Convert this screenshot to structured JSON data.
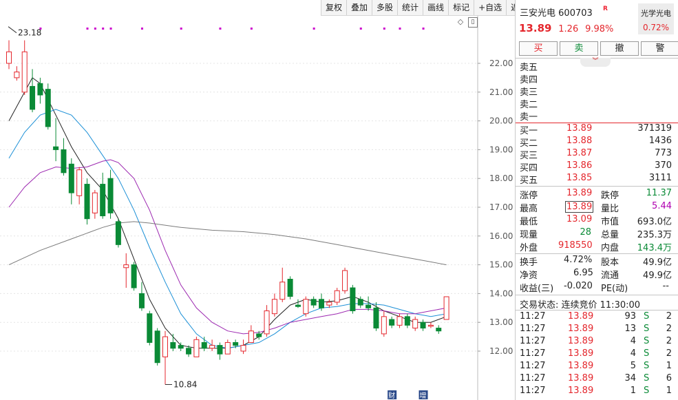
{
  "toolbar": {
    "items": [
      "复权",
      "叠加",
      "多股",
      "统计",
      "画线",
      "标记",
      "+自选",
      "返回"
    ]
  },
  "chart_data": {
    "type": "candlestick",
    "y_ticks": [
      "22.00",
      "21.00",
      "20.00",
      "19.00",
      "18.00",
      "17.00",
      "16.00",
      "15.00",
      "14.00",
      "13.00",
      "12.00"
    ],
    "ylim": [
      11.0,
      23.8
    ],
    "high_label": "23.18",
    "low_label": "10.84",
    "candles": [
      {
        "o": 22.0,
        "c": 22.4,
        "h": 22.8,
        "l": 21.8
      },
      {
        "o": 21.5,
        "c": 21.7,
        "h": 21.9,
        "l": 21.4
      },
      {
        "o": 21.0,
        "c": 22.4,
        "h": 22.8,
        "l": 20.9
      },
      {
        "o": 21.2,
        "c": 20.4,
        "h": 21.8,
        "l": 20.3
      },
      {
        "o": 21.3,
        "c": 20.9,
        "h": 21.5,
        "l": 20.6
      },
      {
        "o": 21.1,
        "c": 19.8,
        "h": 21.3,
        "l": 19.7
      },
      {
        "o": 19.1,
        "c": 19.0,
        "h": 20.1,
        "l": 18.6
      },
      {
        "o": 19.0,
        "c": 18.2,
        "h": 19.4,
        "l": 18.1
      },
      {
        "o": 18.5,
        "c": 17.5,
        "h": 18.7,
        "l": 17.1
      },
      {
        "o": 17.4,
        "c": 18.3,
        "h": 18.4,
        "l": 17.1
      },
      {
        "o": 17.8,
        "c": 16.6,
        "h": 18.0,
        "l": 16.4
      },
      {
        "o": 16.8,
        "c": 17.5,
        "h": 17.6,
        "l": 16.6
      },
      {
        "o": 17.8,
        "c": 16.7,
        "h": 18.2,
        "l": 16.6
      },
      {
        "o": 18.0,
        "c": 16.8,
        "h": 18.3,
        "l": 16.6
      },
      {
        "o": 16.5,
        "c": 15.7,
        "h": 16.6,
        "l": 15.6
      },
      {
        "o": 14.9,
        "c": 15.0,
        "h": 15.4,
        "l": 14.2
      },
      {
        "o": 15.0,
        "c": 14.2,
        "h": 15.1,
        "l": 14.1
      },
      {
        "o": 14.0,
        "c": 13.5,
        "h": 14.4,
        "l": 13.4
      },
      {
        "o": 13.3,
        "c": 12.3,
        "h": 13.4,
        "l": 12.2
      },
      {
        "o": 12.7,
        "c": 11.6,
        "h": 12.8,
        "l": 11.5
      },
      {
        "o": 11.8,
        "c": 12.5,
        "h": 12.7,
        "l": 10.84
      },
      {
        "o": 12.3,
        "c": 12.1,
        "h": 12.6,
        "l": 12.0
      },
      {
        "o": 12.2,
        "c": 12.1,
        "h": 12.3,
        "l": 12.0
      },
      {
        "o": 12.1,
        "c": 11.9,
        "h": 12.2,
        "l": 11.8
      },
      {
        "o": 11.8,
        "c": 12.4,
        "h": 12.5,
        "l": 11.8
      },
      {
        "o": 12.3,
        "c": 12.1,
        "h": 12.5,
        "l": 12.0
      },
      {
        "o": 12.1,
        "c": 12.2,
        "h": 12.4,
        "l": 12.0
      },
      {
        "o": 12.2,
        "c": 11.9,
        "h": 12.3,
        "l": 11.7
      },
      {
        "o": 11.9,
        "c": 12.3,
        "h": 12.4,
        "l": 11.9
      },
      {
        "o": 12.3,
        "c": 12.2,
        "h": 12.4,
        "l": 12.1
      },
      {
        "o": 12.0,
        "c": 12.2,
        "h": 12.4,
        "l": 11.9
      },
      {
        "o": 12.3,
        "c": 12.7,
        "h": 12.9,
        "l": 12.3
      },
      {
        "o": 12.6,
        "c": 12.5,
        "h": 12.7,
        "l": 12.4
      },
      {
        "o": 12.6,
        "c": 13.4,
        "h": 13.6,
        "l": 12.5
      },
      {
        "o": 13.3,
        "c": 13.8,
        "h": 14.0,
        "l": 13.2
      },
      {
        "o": 13.8,
        "c": 14.4,
        "h": 14.9,
        "l": 13.7
      },
      {
        "o": 14.5,
        "c": 13.9,
        "h": 14.6,
        "l": 13.8
      },
      {
        "o": 13.6,
        "c": 13.55,
        "h": 13.8,
        "l": 13.5
      },
      {
        "o": 13.3,
        "c": 13.8,
        "h": 13.9,
        "l": 13.2
      },
      {
        "o": 13.8,
        "c": 13.6,
        "h": 13.9,
        "l": 13.5
      },
      {
        "o": 13.8,
        "c": 13.5,
        "h": 14.0,
        "l": 13.4
      },
      {
        "o": 13.6,
        "c": 13.7,
        "h": 13.8,
        "l": 13.5
      },
      {
        "o": 13.7,
        "c": 14.1,
        "h": 14.2,
        "l": 13.6
      },
      {
        "o": 14.1,
        "c": 14.8,
        "h": 14.9,
        "l": 14.0
      },
      {
        "o": 14.2,
        "c": 13.4,
        "h": 14.3,
        "l": 13.3
      },
      {
        "o": 13.8,
        "c": 13.6,
        "h": 13.9,
        "l": 13.5
      },
      {
        "o": 13.6,
        "c": 13.5,
        "h": 13.9,
        "l": 13.4
      },
      {
        "o": 13.5,
        "c": 12.8,
        "h": 13.7,
        "l": 12.7
      },
      {
        "o": 12.6,
        "c": 13.2,
        "h": 13.4,
        "l": 12.5
      },
      {
        "o": 13.1,
        "c": 12.9,
        "h": 13.2,
        "l": 12.8
      },
      {
        "o": 12.9,
        "c": 13.2,
        "h": 13.3,
        "l": 12.8
      },
      {
        "o": 13.2,
        "c": 12.9,
        "h": 13.3,
        "l": 12.8
      },
      {
        "o": 12.8,
        "c": 13.1,
        "h": 13.2,
        "l": 12.7
      },
      {
        "o": 13.0,
        "c": 12.8,
        "h": 13.1,
        "l": 12.7
      },
      {
        "o": 12.9,
        "c": 12.9,
        "h": 13.0,
        "l": 12.8
      },
      {
        "o": 12.8,
        "c": 12.7,
        "h": 12.9,
        "l": 12.6
      },
      {
        "o": 13.1,
        "c": 13.89,
        "h": 13.89,
        "l": 13.09
      }
    ],
    "series": [
      {
        "color": "#222222",
        "values": [
          [
            0,
            20.0
          ],
          [
            2,
            21.0
          ],
          [
            3,
            21.5
          ],
          [
            4,
            21.3
          ],
          [
            6,
            20.2
          ],
          [
            8,
            19.1
          ],
          [
            10,
            18.2
          ],
          [
            12,
            17.6
          ],
          [
            14,
            16.6
          ],
          [
            16,
            15.2
          ],
          [
            18,
            13.8
          ],
          [
            20,
            12.8
          ],
          [
            22,
            12.2
          ],
          [
            24,
            12.1
          ],
          [
            26,
            12.1
          ],
          [
            28,
            12.1
          ],
          [
            30,
            12.2
          ],
          [
            32,
            12.5
          ],
          [
            34,
            13.1
          ],
          [
            36,
            13.6
          ],
          [
            38,
            13.8
          ],
          [
            40,
            13.7
          ],
          [
            42,
            13.75
          ],
          [
            44,
            13.9
          ],
          [
            46,
            13.7
          ],
          [
            48,
            13.4
          ],
          [
            50,
            13.2
          ],
          [
            52,
            13.0
          ],
          [
            54,
            13.0
          ],
          [
            56,
            13.2
          ]
        ]
      },
      {
        "color": "#1a8fd6",
        "values": [
          [
            0,
            18.7
          ],
          [
            2,
            19.6
          ],
          [
            4,
            20.2
          ],
          [
            6,
            20.4
          ],
          [
            8,
            20.2
          ],
          [
            10,
            19.6
          ],
          [
            12,
            18.8
          ],
          [
            14,
            18.0
          ],
          [
            16,
            16.9
          ],
          [
            18,
            15.6
          ],
          [
            20,
            14.4
          ],
          [
            22,
            13.3
          ],
          [
            24,
            12.6
          ],
          [
            26,
            12.2
          ],
          [
            28,
            12.1
          ],
          [
            30,
            12.2
          ],
          [
            32,
            12.3
          ],
          [
            34,
            12.6
          ],
          [
            36,
            13.0
          ],
          [
            38,
            13.3
          ],
          [
            40,
            13.5
          ],
          [
            42,
            13.55
          ],
          [
            44,
            13.65
          ],
          [
            46,
            13.65
          ],
          [
            48,
            13.6
          ],
          [
            50,
            13.45
          ],
          [
            52,
            13.3
          ],
          [
            54,
            13.2
          ],
          [
            56,
            13.3
          ]
        ]
      },
      {
        "color": "#9c27b0",
        "values": [
          [
            0,
            17.0
          ],
          [
            2,
            17.7
          ],
          [
            4,
            18.2
          ],
          [
            6,
            18.4
          ],
          [
            8,
            18.35
          ],
          [
            10,
            18.4
          ],
          [
            12,
            18.6
          ],
          [
            13,
            18.65
          ],
          [
            14,
            18.55
          ],
          [
            16,
            18.0
          ],
          [
            18,
            16.9
          ],
          [
            20,
            15.5
          ],
          [
            22,
            14.3
          ],
          [
            24,
            13.5
          ],
          [
            26,
            13.0
          ],
          [
            28,
            12.7
          ],
          [
            30,
            12.6
          ],
          [
            32,
            12.65
          ],
          [
            34,
            12.8
          ],
          [
            36,
            13.0
          ],
          [
            38,
            13.1
          ],
          [
            40,
            13.2
          ],
          [
            42,
            13.3
          ],
          [
            44,
            13.45
          ],
          [
            46,
            13.45
          ],
          [
            48,
            13.4
          ],
          [
            50,
            13.3
          ],
          [
            52,
            13.3
          ],
          [
            54,
            13.4
          ],
          [
            56,
            13.5
          ]
        ]
      },
      {
        "color": "#7a7a7a",
        "values": [
          [
            0,
            15.0
          ],
          [
            4,
            15.5
          ],
          [
            8,
            15.9
          ],
          [
            12,
            16.3
          ],
          [
            14,
            16.45
          ],
          [
            16,
            16.5
          ],
          [
            18,
            16.45
          ],
          [
            22,
            16.3
          ],
          [
            26,
            16.2
          ],
          [
            30,
            16.15
          ],
          [
            34,
            16.05
          ],
          [
            38,
            15.9
          ],
          [
            42,
            15.7
          ],
          [
            46,
            15.5
          ],
          [
            50,
            15.3
          ],
          [
            54,
            15.1
          ],
          [
            56,
            15.0
          ]
        ]
      }
    ],
    "top_markers": [
      4,
      10,
      11,
      12,
      13,
      17,
      22,
      27,
      31,
      39,
      45,
      48,
      50,
      53
    ]
  },
  "quote": {
    "name": "三安光电",
    "code": "600703",
    "badge": "R",
    "price": "13.89",
    "change": "1.26",
    "pct": "9.98%",
    "sector_name": "光学光电",
    "sector_pct": "0.72%"
  },
  "buttons": {
    "buy": "买",
    "sell": "卖",
    "cancel": "撤",
    "alert": "警",
    "fold": "︾"
  },
  "asks": [
    {
      "label": "卖五",
      "price": "",
      "vol": ""
    },
    {
      "label": "卖四",
      "price": "",
      "vol": ""
    },
    {
      "label": "卖三",
      "price": "",
      "vol": ""
    },
    {
      "label": "卖二",
      "price": "",
      "vol": ""
    },
    {
      "label": "卖一",
      "price": "",
      "vol": ""
    }
  ],
  "bids": [
    {
      "label": "买一",
      "price": "13.89",
      "vol": "371319"
    },
    {
      "label": "买二",
      "price": "13.88",
      "vol": "1436"
    },
    {
      "label": "买三",
      "price": "13.87",
      "vol": "773"
    },
    {
      "label": "买四",
      "price": "13.86",
      "vol": "370"
    },
    {
      "label": "买五",
      "price": "13.85",
      "vol": "3111"
    }
  ],
  "stats": {
    "limit_up_label": "涨停",
    "limit_up": "13.89",
    "limit_down_label": "跌停",
    "limit_down": "11.37",
    "high_label": "最高",
    "high": "13.89",
    "vol_ratio_label": "量比",
    "vol_ratio": "5.44",
    "low_label": "最低",
    "low": "13.09",
    "mktcap_label": "市值",
    "mktcap": "693.0亿",
    "last_vol_label": "现量",
    "last_vol": "28",
    "total_vol_label": "总量",
    "total_vol": "235.3万",
    "outer_label": "外盘",
    "outer": "918550",
    "inner_label": "内盘",
    "inner": "143.4万"
  },
  "fund": {
    "turnover_label": "换手",
    "turnover": "4.72%",
    "equity_label": "股本",
    "equity": "49.9亿",
    "nav_label": "净资",
    "nav": "6.95",
    "float_label": "流通",
    "float": "49.9亿",
    "eps_label": "收益(三)",
    "eps": "-0.020",
    "pe_label": "PE(动)",
    "pe": "--"
  },
  "trade_status": "交易状态: 连续竞价 11:30:00",
  "ticks": [
    {
      "time": "11:27",
      "price": "13.89",
      "vol": "93",
      "side": "S",
      "n": "2"
    },
    {
      "time": "11:27",
      "price": "13.89",
      "vol": "13",
      "side": "S",
      "n": "2"
    },
    {
      "time": "11:27",
      "price": "13.89",
      "vol": "4",
      "side": "S",
      "n": "2"
    },
    {
      "time": "11:27",
      "price": "13.89",
      "vol": "4",
      "side": "S",
      "n": "2"
    },
    {
      "time": "11:27",
      "price": "13.89",
      "vol": "5",
      "side": "S",
      "n": "1"
    },
    {
      "time": "11:27",
      "price": "13.89",
      "vol": "34",
      "side": "S",
      "n": "6"
    },
    {
      "time": "11:27",
      "price": "13.89",
      "vol": "1",
      "side": "S",
      "n": "1"
    }
  ],
  "badges": {
    "fin": "财",
    "inc": "增"
  },
  "colors": {
    "up": "#e4262c",
    "down": "#0a8a36",
    "marker": "#cc00cc"
  }
}
